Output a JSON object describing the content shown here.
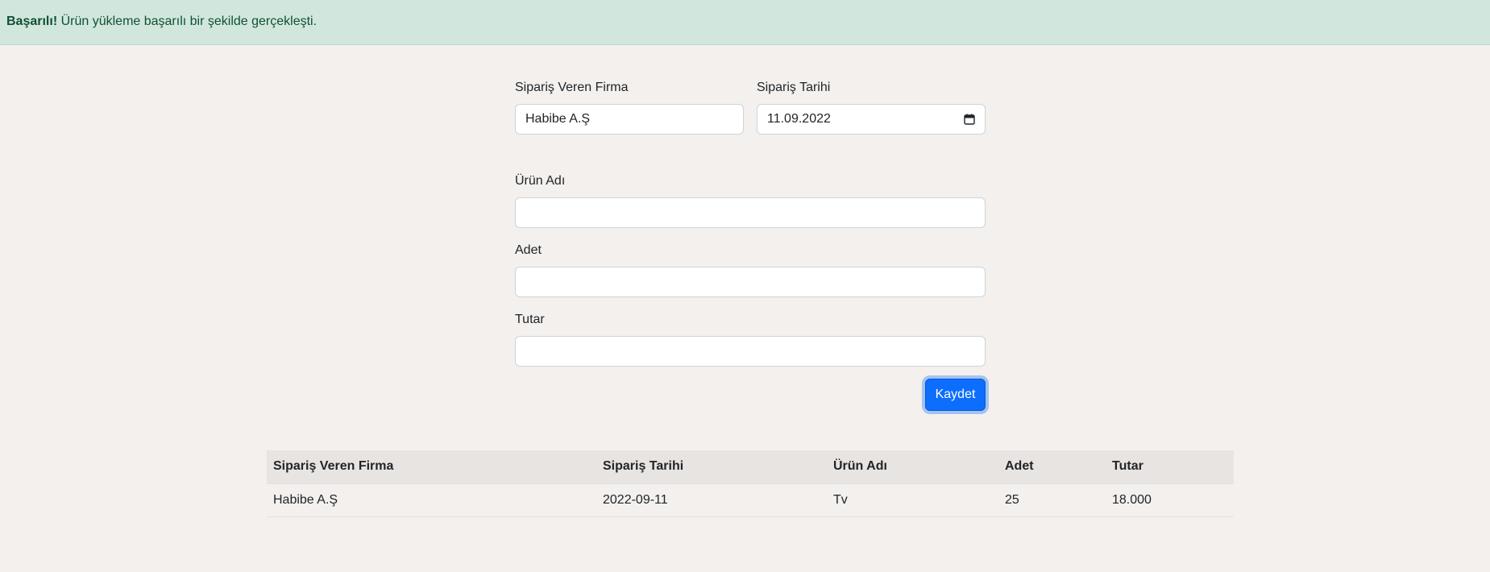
{
  "alert": {
    "strong": "Başarılı!",
    "message": " Ürün yükleme başarılı bir şekilde gerçekleşti."
  },
  "form": {
    "firm_label": "Sipariş Veren Firma",
    "firm_value": "Habibe A.Ş",
    "date_label": "Sipariş Tarihi",
    "date_value": "11.09.2022",
    "product_label": "Ürün Adı",
    "product_value": "",
    "quantity_label": "Adet",
    "quantity_value": "",
    "amount_label": "Tutar",
    "amount_value": "",
    "save_label": "Kaydet"
  },
  "table": {
    "headers": [
      "Sipariş Veren Firma",
      "Sipariş Tarihi",
      "Ürün Adı",
      "Adet",
      "Tutar"
    ],
    "rows": [
      [
        "Habibe A.Ş",
        "2022-09-11",
        "Tv",
        "25",
        "18.000"
      ]
    ]
  }
}
